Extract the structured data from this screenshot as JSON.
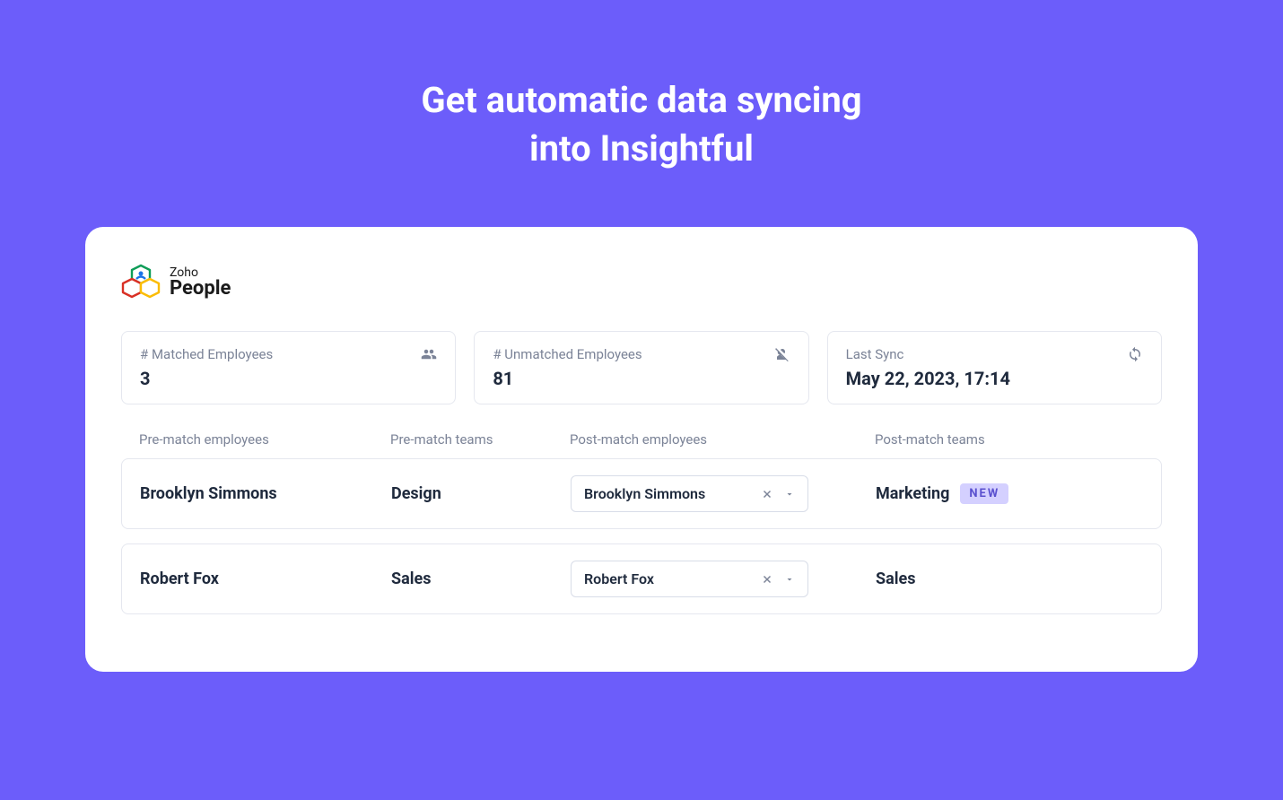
{
  "hero": {
    "line1": "Get automatic data syncing",
    "line2": "into Insightful"
  },
  "brand": {
    "top": "Zoho",
    "bottom": "People"
  },
  "stats": {
    "matched": {
      "label": "# Matched Employees",
      "value": "3"
    },
    "unmatched": {
      "label": "# Unmatched Employees",
      "value": "81"
    },
    "lastSync": {
      "label": "Last Sync",
      "value": "May 22, 2023, 17:14"
    }
  },
  "headers": {
    "preEmp": "Pre-match employees",
    "preTeam": "Pre-match teams",
    "postEmp": "Post-match employees",
    "postTeam": "Post-match teams"
  },
  "rows": [
    {
      "preEmp": "Brooklyn Simmons",
      "preTeam": "Design",
      "postEmp": "Brooklyn Simmons",
      "postTeam": "Marketing",
      "badge": "NEW"
    },
    {
      "preEmp": "Robert Fox",
      "preTeam": "Sales",
      "postEmp": "Robert Fox",
      "postTeam": "Sales",
      "badge": ""
    }
  ]
}
